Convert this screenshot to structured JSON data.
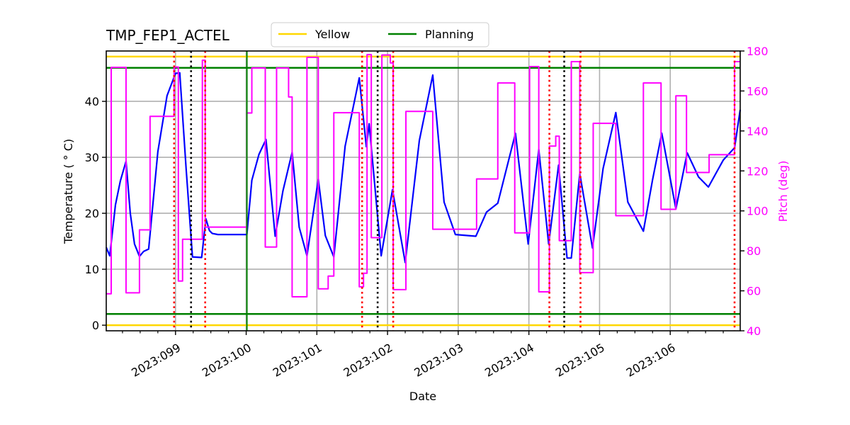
{
  "chart_data": {
    "type": "line",
    "title": "TMP_FEP1_ACTEL",
    "xlabel": "Date",
    "ylabel": "Temperature ($^\\circ$C)",
    "ylabel_display": "Temperature ( ° C)",
    "y2label": "Pitch (deg)",
    "x_units": "day-of-year 2023",
    "xlim": [
      98.02,
      106.99
    ],
    "ylim": [
      -1,
      49
    ],
    "y2lim": [
      40,
      180
    ],
    "grid": true,
    "x_ticks": [
      {
        "value": 99,
        "label": "2023:099"
      },
      {
        "value": 100,
        "label": "2023:100"
      },
      {
        "value": 101,
        "label": "2023:101"
      },
      {
        "value": 102,
        "label": "2023:102"
      },
      {
        "value": 103,
        "label": "2023:103"
      },
      {
        "value": 104,
        "label": "2023:104"
      },
      {
        "value": 105,
        "label": "2023:105"
      },
      {
        "value": 106,
        "label": "2023:106"
      }
    ],
    "x_minor_tick_step": 0.25,
    "y_ticks": [
      0,
      10,
      20,
      30,
      40
    ],
    "y2_ticks": [
      40,
      60,
      80,
      100,
      120,
      140,
      160,
      180
    ],
    "legend": {
      "placement": "top-center-above",
      "entries": [
        {
          "label": "Yellow",
          "color": "#ffd700"
        },
        {
          "label": "Planning",
          "color": "#008000"
        }
      ]
    },
    "hlines": [
      {
        "name": "yellow-high",
        "value": 48,
        "color": "#ffd700",
        "group": "Yellow"
      },
      {
        "name": "yellow-low",
        "value": 0,
        "color": "#ffd700",
        "group": "Yellow"
      },
      {
        "name": "planning-high",
        "value": 46,
        "color": "#008000",
        "group": "Planning"
      },
      {
        "name": "planning-low",
        "value": 2,
        "color": "#008000",
        "group": "Planning"
      }
    ],
    "vlines": [
      {
        "value": 98.98,
        "color": "#ff0000",
        "style": "dotted"
      },
      {
        "value": 99.22,
        "color": "#000000",
        "style": "dotted"
      },
      {
        "value": 99.42,
        "color": "#ff0000",
        "style": "dotted"
      },
      {
        "value": 100.01,
        "color": "#008000",
        "style": "solid"
      },
      {
        "value": 101.64,
        "color": "#ff0000",
        "style": "dotted"
      },
      {
        "value": 101.86,
        "color": "#000000",
        "style": "dotted"
      },
      {
        "value": 102.08,
        "color": "#ff0000",
        "style": "dotted"
      },
      {
        "value": 104.29,
        "color": "#ff0000",
        "style": "dotted"
      },
      {
        "value": 104.5,
        "color": "#000000",
        "style": "dotted"
      },
      {
        "value": 104.73,
        "color": "#ff0000",
        "style": "dotted"
      },
      {
        "value": 106.91,
        "color": "#ff0000",
        "style": "dotted"
      }
    ],
    "series": [
      {
        "name": "Temperature",
        "axis": "left",
        "color": "#0000ff",
        "x": [
          98.02,
          98.07,
          98.15,
          98.22,
          98.3,
          98.36,
          98.42,
          98.49,
          98.55,
          98.62,
          98.75,
          98.88,
          99.0,
          99.06,
          99.15,
          99.24,
          99.37,
          99.43,
          99.48,
          99.52,
          99.6,
          100.01,
          100.08,
          100.18,
          100.28,
          100.41,
          100.52,
          100.65,
          100.75,
          100.86,
          101.02,
          101.12,
          101.24,
          101.4,
          101.6,
          101.7,
          101.74,
          101.91,
          102.07,
          102.25,
          102.45,
          102.64,
          102.8,
          102.96,
          103.25,
          103.4,
          103.56,
          103.81,
          103.99,
          104.14,
          104.28,
          104.42,
          104.54,
          104.6,
          104.72,
          104.9,
          105.05,
          105.23,
          105.4,
          105.62,
          105.75,
          105.88,
          106.08,
          106.24,
          106.4,
          106.54,
          106.75,
          106.91,
          106.99
        ],
        "values": [
          13.9,
          12.4,
          21.5,
          25.8,
          29.3,
          20.0,
          14.5,
          12.3,
          13.2,
          13.6,
          31.0,
          41.0,
          45.0,
          45.1,
          28.0,
          12.2,
          12.1,
          19.0,
          16.9,
          16.4,
          16.2,
          16.2,
          25.9,
          30.5,
          33.2,
          15.9,
          24.0,
          30.9,
          17.5,
          12.4,
          26.1,
          16.0,
          12.2,
          32.0,
          44.2,
          31.9,
          36.0,
          12.4,
          24.2,
          11.2,
          33.0,
          44.7,
          22.0,
          16.2,
          15.9,
          20.2,
          21.8,
          34.3,
          14.5,
          31.4,
          14.5,
          28.6,
          12.0,
          12.0,
          27.1,
          13.8,
          28.0,
          38.0,
          22.0,
          16.8,
          26.0,
          34.3,
          20.8,
          30.8,
          26.5,
          24.7,
          29.5,
          31.7,
          38.5
        ]
      },
      {
        "name": "Pitch",
        "axis": "right",
        "color": "#ff00ff",
        "step": true,
        "x": [
          98.02,
          98.09,
          98.3,
          98.49,
          98.64,
          98.98,
          99.04,
          99.1,
          99.38,
          99.42,
          100.01,
          100.08,
          100.27,
          100.43,
          100.6,
          100.65,
          100.86,
          101.02,
          101.16,
          101.24,
          101.6,
          101.66,
          101.71,
          101.77,
          101.92,
          102.04,
          102.08,
          102.26,
          102.64,
          103.26,
          103.56,
          103.8,
          104.01,
          104.14,
          104.29,
          104.38,
          104.43,
          104.6,
          104.72,
          104.91,
          105.23,
          105.62,
          105.87,
          106.08,
          106.23,
          106.55,
          106.91,
          106.99
        ],
        "values": [
          58.5,
          171.8,
          59.0,
          90.5,
          147.3,
          172.0,
          64.9,
          85.8,
          175.4,
          91.9,
          149.0,
          171.5,
          81.9,
          171.5,
          157.0,
          57.0,
          176.8,
          61.0,
          67.4,
          149.1,
          62.0,
          68.8,
          178.2,
          86.6,
          178.0,
          174.0,
          60.6,
          149.8,
          90.8,
          116.0,
          164.0,
          89.0,
          172.2,
          59.5,
          132.4,
          137.4,
          85.1,
          174.7,
          69.1,
          143.8,
          97.6,
          164.0,
          100.8,
          157.6,
          119.2,
          128.1,
          174.7,
          174.7
        ]
      }
    ]
  }
}
